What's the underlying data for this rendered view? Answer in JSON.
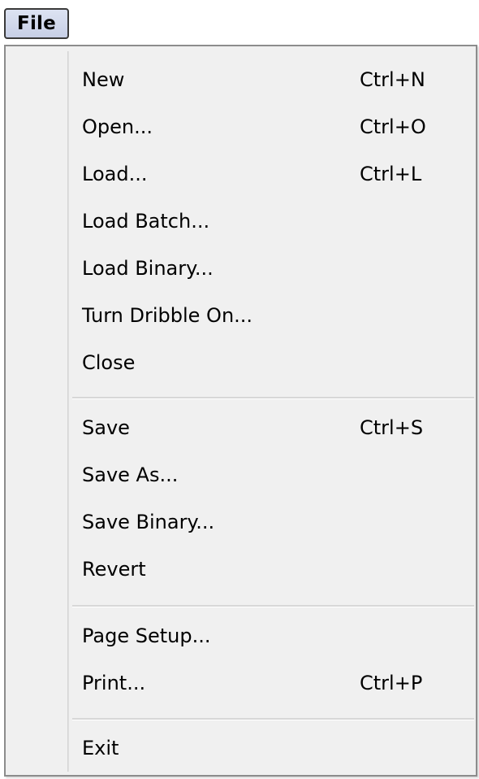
{
  "menubar": {
    "file_label": "File"
  },
  "file_menu": {
    "items": [
      {
        "label": "New",
        "shortcut": "Ctrl+N"
      },
      {
        "label": "Open...",
        "shortcut": "Ctrl+O"
      },
      {
        "label": "Load...",
        "shortcut": "Ctrl+L"
      },
      {
        "label": "Load Batch...",
        "shortcut": ""
      },
      {
        "label": "Load Binary...",
        "shortcut": ""
      },
      {
        "label": "Turn Dribble On...",
        "shortcut": ""
      },
      {
        "label": "Close",
        "shortcut": ""
      },
      {
        "label": "Save",
        "shortcut": "Ctrl+S"
      },
      {
        "label": "Save As...",
        "shortcut": ""
      },
      {
        "label": "Save Binary...",
        "shortcut": ""
      },
      {
        "label": "Revert",
        "shortcut": ""
      },
      {
        "label": "Page Setup...",
        "shortcut": ""
      },
      {
        "label": "Print...",
        "shortcut": "Ctrl+P"
      },
      {
        "label": "Exit",
        "shortcut": ""
      }
    ]
  }
}
